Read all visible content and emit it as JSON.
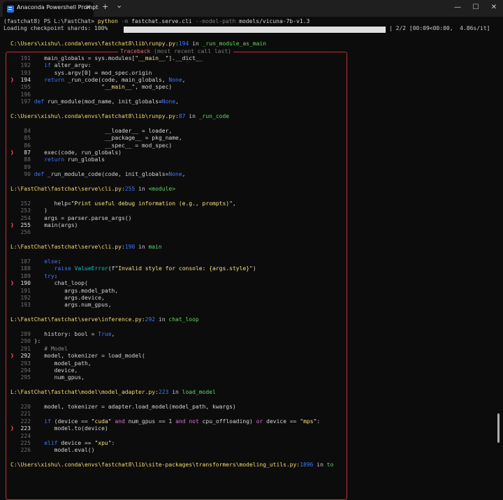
{
  "window": {
    "tab_title": "Anaconda Powershell Prompt",
    "tab_close": "×",
    "new_tab": "+",
    "dropdown": "⌄",
    "minimize": "—",
    "maximize": "☐",
    "close": "✕"
  },
  "terminal": {
    "prompt": "(fastchat8) PS L:\\FastChat> ",
    "cmd_python": "python",
    "cmd_m": " -m ",
    "cmd_module": "fastchat.serve.cli",
    "cmd_flag": " --model-path ",
    "cmd_path": "models/vicuna-7b-v1.3",
    "loading_label": "Loading checkpoint shards: 100%",
    "loading_stats": "| 2/2 [00:09<00:00,  4.86s/it]",
    "traceback_title": "Traceback ",
    "traceback_hint": "(most recent call last)",
    "frames": [
      {
        "file": "C:\\Users\\xishu\\.conda\\envs\\fastchat8\\lib\\runpy.py",
        "line": "194",
        "func": "_run_module_as_main",
        "code": [
          [
            "191",
            "   main_globals = sys.modules[\"__main__\"].__dict__"
          ],
          [
            "192",
            "   if alter_argv:"
          ],
          [
            "193",
            "      sys.argv[0] = mod_spec.origin"
          ],
          [
            "194",
            "   return _run_code(code, main_globals, None,"
          ],
          [
            "195",
            "                    \"__main__\", mod_spec)"
          ],
          [
            "196",
            ""
          ],
          [
            "197",
            "def run_module(mod_name, init_globals=None,"
          ]
        ]
      },
      {
        "file": "C:\\Users\\xishu\\.conda\\envs\\fastchat8\\lib\\runpy.py",
        "line": "87",
        "func": "_run_code",
        "code": [
          [
            "84",
            "                     __loader__ = loader,"
          ],
          [
            "85",
            "                     __package__ = pkg_name,"
          ],
          [
            "86",
            "                     __spec__ = mod_spec)"
          ],
          [
            "87",
            "   exec(code, run_globals)"
          ],
          [
            "88",
            "   return run_globals"
          ],
          [
            "89",
            ""
          ],
          [
            "90",
            "def _run_module_code(code, init_globals=None,"
          ]
        ]
      },
      {
        "file": "L:\\FastChat\\fastchat\\serve\\cli.py",
        "line": "255",
        "func": "<module>",
        "code": [
          [
            "252",
            "      help=\"Print useful debug information (e.g., prompts)\","
          ],
          [
            "253",
            "   )"
          ],
          [
            "254",
            "   args = parser.parse_args()"
          ],
          [
            "255",
            "   main(args)"
          ],
          [
            "256",
            ""
          ]
        ]
      },
      {
        "file": "L:\\FastChat\\fastchat\\serve\\cli.py",
        "line": "190",
        "func": "main",
        "code": [
          [
            "187",
            "   else:"
          ],
          [
            "188",
            "      raise ValueError(f\"Invalid style for console: {args.style}\")"
          ],
          [
            "189",
            "   try:"
          ],
          [
            "190",
            "      chat_loop("
          ],
          [
            "191",
            "         args.model_path,"
          ],
          [
            "192",
            "         args.device,"
          ],
          [
            "193",
            "         args.num_gpus,"
          ]
        ]
      },
      {
        "file": "L:\\FastChat\\fastchat\\serve\\inference.py",
        "line": "292",
        "func": "chat_loop",
        "code": [
          [
            "289",
            "   history: bool = True,"
          ],
          [
            "290",
            "):"
          ],
          [
            "291",
            "   # Model"
          ],
          [
            "292",
            "   model, tokenizer = load_model("
          ],
          [
            "293",
            "      model_path,"
          ],
          [
            "294",
            "      device,"
          ],
          [
            "295",
            "      num_gpus,"
          ]
        ]
      },
      {
        "file": "L:\\FastChat\\fastchat\\model\\model_adapter.py",
        "line": "223",
        "func": "load_model",
        "code": [
          [
            "220",
            "   model, tokenizer = adapter.load_model(model_path, kwargs)"
          ],
          [
            "221",
            ""
          ],
          [
            "222",
            "   if (device == \"cuda\" and num_gpus == 1 and not cpu_offloading) or device == \"mps\":"
          ],
          [
            "223",
            "      model.to(device)"
          ],
          [
            "224",
            ""
          ],
          [
            "225",
            "   elif device == \"xpu\":"
          ],
          [
            "226",
            "      model.eval()"
          ]
        ]
      },
      {
        "file": "C:\\Users\\xishu\\.conda\\envs\\fastchat8\\lib\\site-packages\\transformers\\modeling_utils.py",
        "line": "1896",
        "func": "to",
        "code": []
      }
    ]
  }
}
